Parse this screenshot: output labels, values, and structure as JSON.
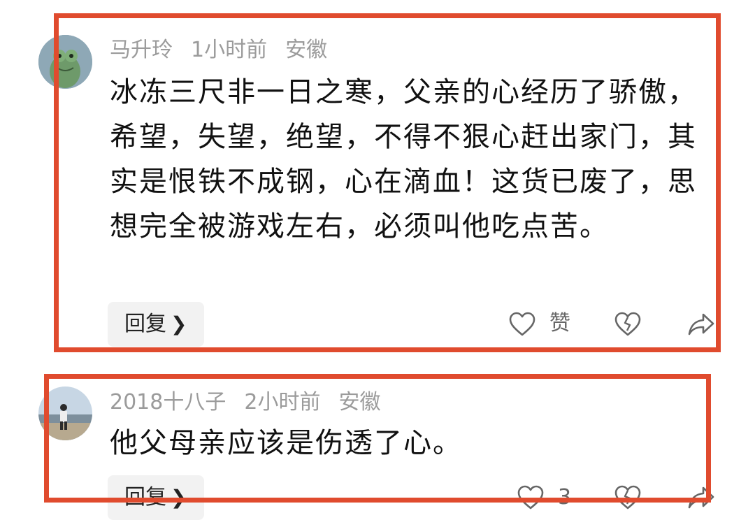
{
  "comments": [
    {
      "author": "马升玲",
      "time": "1小时前",
      "location": "安徽",
      "avatar_icon": "green-frog-avatar",
      "text": "冰冻三尺非一日之寒，父亲的心经历了骄傲，希望，失望，绝望，不得不狠心赶出家门，其实是恨铁不成钢，心在滴血！这货已废了，思想完全被游戏左右，必须叫他吃点苦。",
      "reply_label": "回复",
      "like_label": "赞",
      "icons": [
        "heart-outline-icon",
        "broken-heart-icon",
        "share-icon"
      ]
    },
    {
      "author": "2018十八子",
      "time": "2小时前",
      "location": "安徽",
      "avatar_icon": "photo-avatar",
      "text": "他父母亲应该是伤透了心。",
      "reply_label": "回复",
      "like_label": "3",
      "icons": [
        "heart-outline-icon",
        "broken-heart-icon",
        "share-icon"
      ]
    }
  ],
  "colors": {
    "highlight": "#e04b2e",
    "meta_text": "#9b9b9b",
    "body_text": "#111111",
    "reply_bg": "#f2f2f2"
  }
}
